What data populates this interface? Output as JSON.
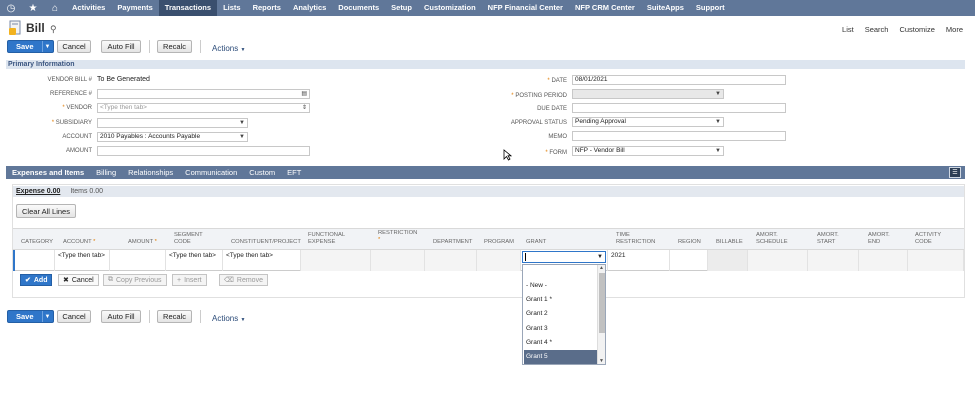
{
  "nav": {
    "icons": [
      "history-icon",
      "star-icon",
      "home-icon"
    ],
    "items": [
      "Activities",
      "Payments",
      "Transactions",
      "Lists",
      "Reports",
      "Analytics",
      "Documents",
      "Setup",
      "Customization",
      "NFP Financial Center",
      "NFP CRM Center",
      "SuiteApps",
      "Support"
    ],
    "active": "Transactions"
  },
  "header": {
    "title": "Bill",
    "links": [
      "List",
      "Search",
      "Customize",
      "More"
    ]
  },
  "toolbar": {
    "save": "Save",
    "cancel": "Cancel",
    "autofill": "Auto Fill",
    "recalc": "Recalc",
    "actions": "Actions"
  },
  "primary": {
    "section_title": "Primary Information",
    "vendor_bill_label": "VENDOR BILL #",
    "vendor_bill_value": "To Be Generated",
    "reference_label": "REFERENCE #",
    "vendor_label": "VENDOR",
    "vendor_placeholder": "<Type then tab>",
    "subsidiary_label": "SUBSIDIARY",
    "account_label": "ACCOUNT",
    "account_value": "2010 Payables : Accounts Payable",
    "amount_label": "AMOUNT",
    "date_label": "DATE",
    "date_value": "08/01/2021",
    "posting_period_label": "POSTING PERIOD",
    "due_date_label": "DUE DATE",
    "approval_label": "APPROVAL STATUS",
    "approval_value": "Pending Approval",
    "memo_label": "MEMO",
    "form_label": "FORM",
    "form_value": "NFP - Vendor Bill"
  },
  "subtabs": [
    "Expenses and Items",
    "Billing",
    "Relationships",
    "Communication",
    "Custom",
    "EFT"
  ],
  "lines": {
    "expense_tab": "Expense 0.00",
    "items_tab": "Items 0.00",
    "clear_all": "Clear All Lines",
    "columns": [
      "CATEGORY",
      "ACCOUNT",
      "AMOUNT",
      "SEGMENT CODE",
      "CONSTITUENT/PROJECT",
      "FUNCTIONAL EXPENSE",
      "RESTRICTION",
      "DEPARTMENT",
      "PROGRAM",
      "GRANT",
      "TIME RESTRICTION",
      "REGION",
      "BILLABLE",
      "AMORT. SCHEDULE",
      "AMORT. START",
      "AMORT. END",
      "ACTIVITY CODE"
    ],
    "row": {
      "account": "<Type then tab>",
      "segment": "<Type then tab>",
      "constituent": "<Type then tab>",
      "time_restriction": "2021"
    },
    "buttons": {
      "add": "Add",
      "cancel": "Cancel",
      "copy": "Copy Previous",
      "insert": "Insert",
      "remove": "Remove"
    },
    "grant_options": [
      "- New -",
      "Grant 1 *",
      "Grant 2",
      "Grant 3",
      "Grant 4 *",
      "Grant 5"
    ],
    "grant_selected": "Grant 5"
  }
}
